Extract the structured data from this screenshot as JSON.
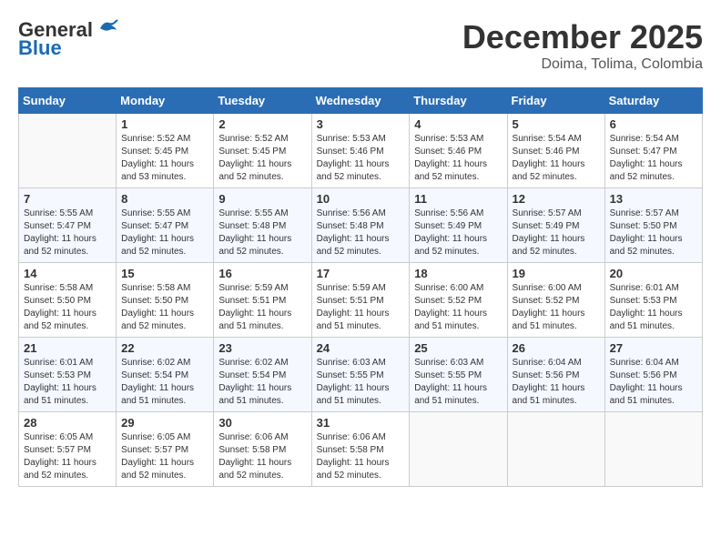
{
  "header": {
    "logo_general": "General",
    "logo_blue": "Blue",
    "month": "December 2025",
    "location": "Doima, Tolima, Colombia"
  },
  "weekdays": [
    "Sunday",
    "Monday",
    "Tuesday",
    "Wednesday",
    "Thursday",
    "Friday",
    "Saturday"
  ],
  "weeks": [
    [
      {
        "day": "",
        "info": ""
      },
      {
        "day": "1",
        "info": "Sunrise: 5:52 AM\nSunset: 5:45 PM\nDaylight: 11 hours\nand 53 minutes."
      },
      {
        "day": "2",
        "info": "Sunrise: 5:52 AM\nSunset: 5:45 PM\nDaylight: 11 hours\nand 52 minutes."
      },
      {
        "day": "3",
        "info": "Sunrise: 5:53 AM\nSunset: 5:46 PM\nDaylight: 11 hours\nand 52 minutes."
      },
      {
        "day": "4",
        "info": "Sunrise: 5:53 AM\nSunset: 5:46 PM\nDaylight: 11 hours\nand 52 minutes."
      },
      {
        "day": "5",
        "info": "Sunrise: 5:54 AM\nSunset: 5:46 PM\nDaylight: 11 hours\nand 52 minutes."
      },
      {
        "day": "6",
        "info": "Sunrise: 5:54 AM\nSunset: 5:47 PM\nDaylight: 11 hours\nand 52 minutes."
      }
    ],
    [
      {
        "day": "7",
        "info": "Sunrise: 5:55 AM\nSunset: 5:47 PM\nDaylight: 11 hours\nand 52 minutes."
      },
      {
        "day": "8",
        "info": "Sunrise: 5:55 AM\nSunset: 5:47 PM\nDaylight: 11 hours\nand 52 minutes."
      },
      {
        "day": "9",
        "info": "Sunrise: 5:55 AM\nSunset: 5:48 PM\nDaylight: 11 hours\nand 52 minutes."
      },
      {
        "day": "10",
        "info": "Sunrise: 5:56 AM\nSunset: 5:48 PM\nDaylight: 11 hours\nand 52 minutes."
      },
      {
        "day": "11",
        "info": "Sunrise: 5:56 AM\nSunset: 5:49 PM\nDaylight: 11 hours\nand 52 minutes."
      },
      {
        "day": "12",
        "info": "Sunrise: 5:57 AM\nSunset: 5:49 PM\nDaylight: 11 hours\nand 52 minutes."
      },
      {
        "day": "13",
        "info": "Sunrise: 5:57 AM\nSunset: 5:50 PM\nDaylight: 11 hours\nand 52 minutes."
      }
    ],
    [
      {
        "day": "14",
        "info": "Sunrise: 5:58 AM\nSunset: 5:50 PM\nDaylight: 11 hours\nand 52 minutes."
      },
      {
        "day": "15",
        "info": "Sunrise: 5:58 AM\nSunset: 5:50 PM\nDaylight: 11 hours\nand 52 minutes."
      },
      {
        "day": "16",
        "info": "Sunrise: 5:59 AM\nSunset: 5:51 PM\nDaylight: 11 hours\nand 51 minutes."
      },
      {
        "day": "17",
        "info": "Sunrise: 5:59 AM\nSunset: 5:51 PM\nDaylight: 11 hours\nand 51 minutes."
      },
      {
        "day": "18",
        "info": "Sunrise: 6:00 AM\nSunset: 5:52 PM\nDaylight: 11 hours\nand 51 minutes."
      },
      {
        "day": "19",
        "info": "Sunrise: 6:00 AM\nSunset: 5:52 PM\nDaylight: 11 hours\nand 51 minutes."
      },
      {
        "day": "20",
        "info": "Sunrise: 6:01 AM\nSunset: 5:53 PM\nDaylight: 11 hours\nand 51 minutes."
      }
    ],
    [
      {
        "day": "21",
        "info": "Sunrise: 6:01 AM\nSunset: 5:53 PM\nDaylight: 11 hours\nand 51 minutes."
      },
      {
        "day": "22",
        "info": "Sunrise: 6:02 AM\nSunset: 5:54 PM\nDaylight: 11 hours\nand 51 minutes."
      },
      {
        "day": "23",
        "info": "Sunrise: 6:02 AM\nSunset: 5:54 PM\nDaylight: 11 hours\nand 51 minutes."
      },
      {
        "day": "24",
        "info": "Sunrise: 6:03 AM\nSunset: 5:55 PM\nDaylight: 11 hours\nand 51 minutes."
      },
      {
        "day": "25",
        "info": "Sunrise: 6:03 AM\nSunset: 5:55 PM\nDaylight: 11 hours\nand 51 minutes."
      },
      {
        "day": "26",
        "info": "Sunrise: 6:04 AM\nSunset: 5:56 PM\nDaylight: 11 hours\nand 51 minutes."
      },
      {
        "day": "27",
        "info": "Sunrise: 6:04 AM\nSunset: 5:56 PM\nDaylight: 11 hours\nand 51 minutes."
      }
    ],
    [
      {
        "day": "28",
        "info": "Sunrise: 6:05 AM\nSunset: 5:57 PM\nDaylight: 11 hours\nand 52 minutes."
      },
      {
        "day": "29",
        "info": "Sunrise: 6:05 AM\nSunset: 5:57 PM\nDaylight: 11 hours\nand 52 minutes."
      },
      {
        "day": "30",
        "info": "Sunrise: 6:06 AM\nSunset: 5:58 PM\nDaylight: 11 hours\nand 52 minutes."
      },
      {
        "day": "31",
        "info": "Sunrise: 6:06 AM\nSunset: 5:58 PM\nDaylight: 11 hours\nand 52 minutes."
      },
      {
        "day": "",
        "info": ""
      },
      {
        "day": "",
        "info": ""
      },
      {
        "day": "",
        "info": ""
      }
    ]
  ]
}
